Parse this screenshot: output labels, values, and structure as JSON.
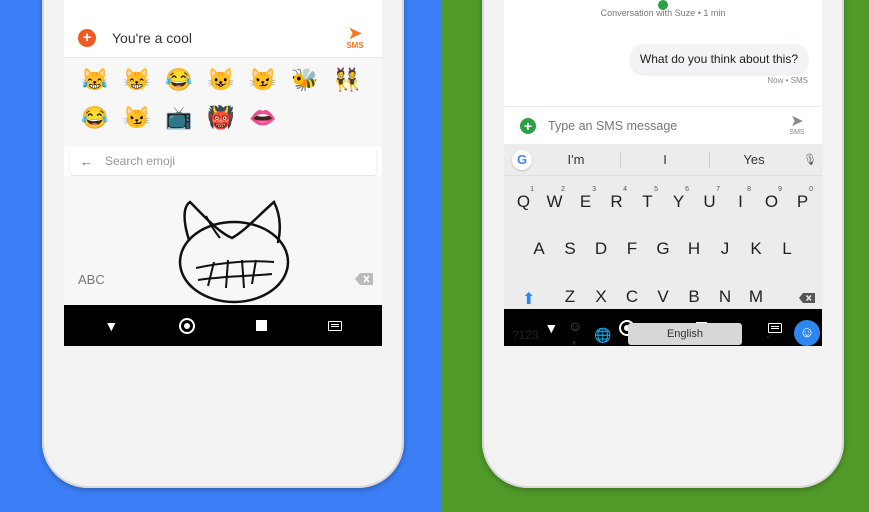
{
  "left": {
    "compose_text": "You're a cool",
    "send_label": "SMS",
    "emoji_row1": [
      "😹",
      "😸",
      "😂",
      "😺",
      "😼",
      "🐝",
      "👯"
    ],
    "emoji_row2": [
      "😂",
      "😼",
      "📺",
      "👹",
      "👄"
    ],
    "search_placeholder": "Search emoji",
    "abc_label": "ABC"
  },
  "right": {
    "conversation_hint": "Conversation with Suze • 1 min",
    "message": "What do you think about this?",
    "message_meta": "Now • SMS",
    "input_placeholder": "Type an SMS message",
    "send_label": "SMS",
    "suggestions": [
      "I'm",
      "I",
      "Yes"
    ],
    "row1": [
      {
        "k": "Q",
        "n": "1"
      },
      {
        "k": "W",
        "n": "2"
      },
      {
        "k": "E",
        "n": "3"
      },
      {
        "k": "R",
        "n": "4"
      },
      {
        "k": "T",
        "n": "5"
      },
      {
        "k": "Y",
        "n": "6"
      },
      {
        "k": "U",
        "n": "7"
      },
      {
        "k": "I",
        "n": "8"
      },
      {
        "k": "O",
        "n": "9"
      },
      {
        "k": "P",
        "n": "0"
      }
    ],
    "row2": [
      "A",
      "S",
      "D",
      "F",
      "G",
      "H",
      "J",
      "K",
      "L"
    ],
    "row3": [
      "Z",
      "X",
      "C",
      "V",
      "B",
      "N",
      "M"
    ],
    "sym_key": "?123",
    "space_label": "English",
    "period_key": "."
  },
  "colors": {
    "left_bg": "#3b7ef5",
    "right_bg": "#4f9a28",
    "orange_accent": "#f15a22",
    "green_accent": "#2ea043",
    "blue_accent": "#2d87f0"
  }
}
